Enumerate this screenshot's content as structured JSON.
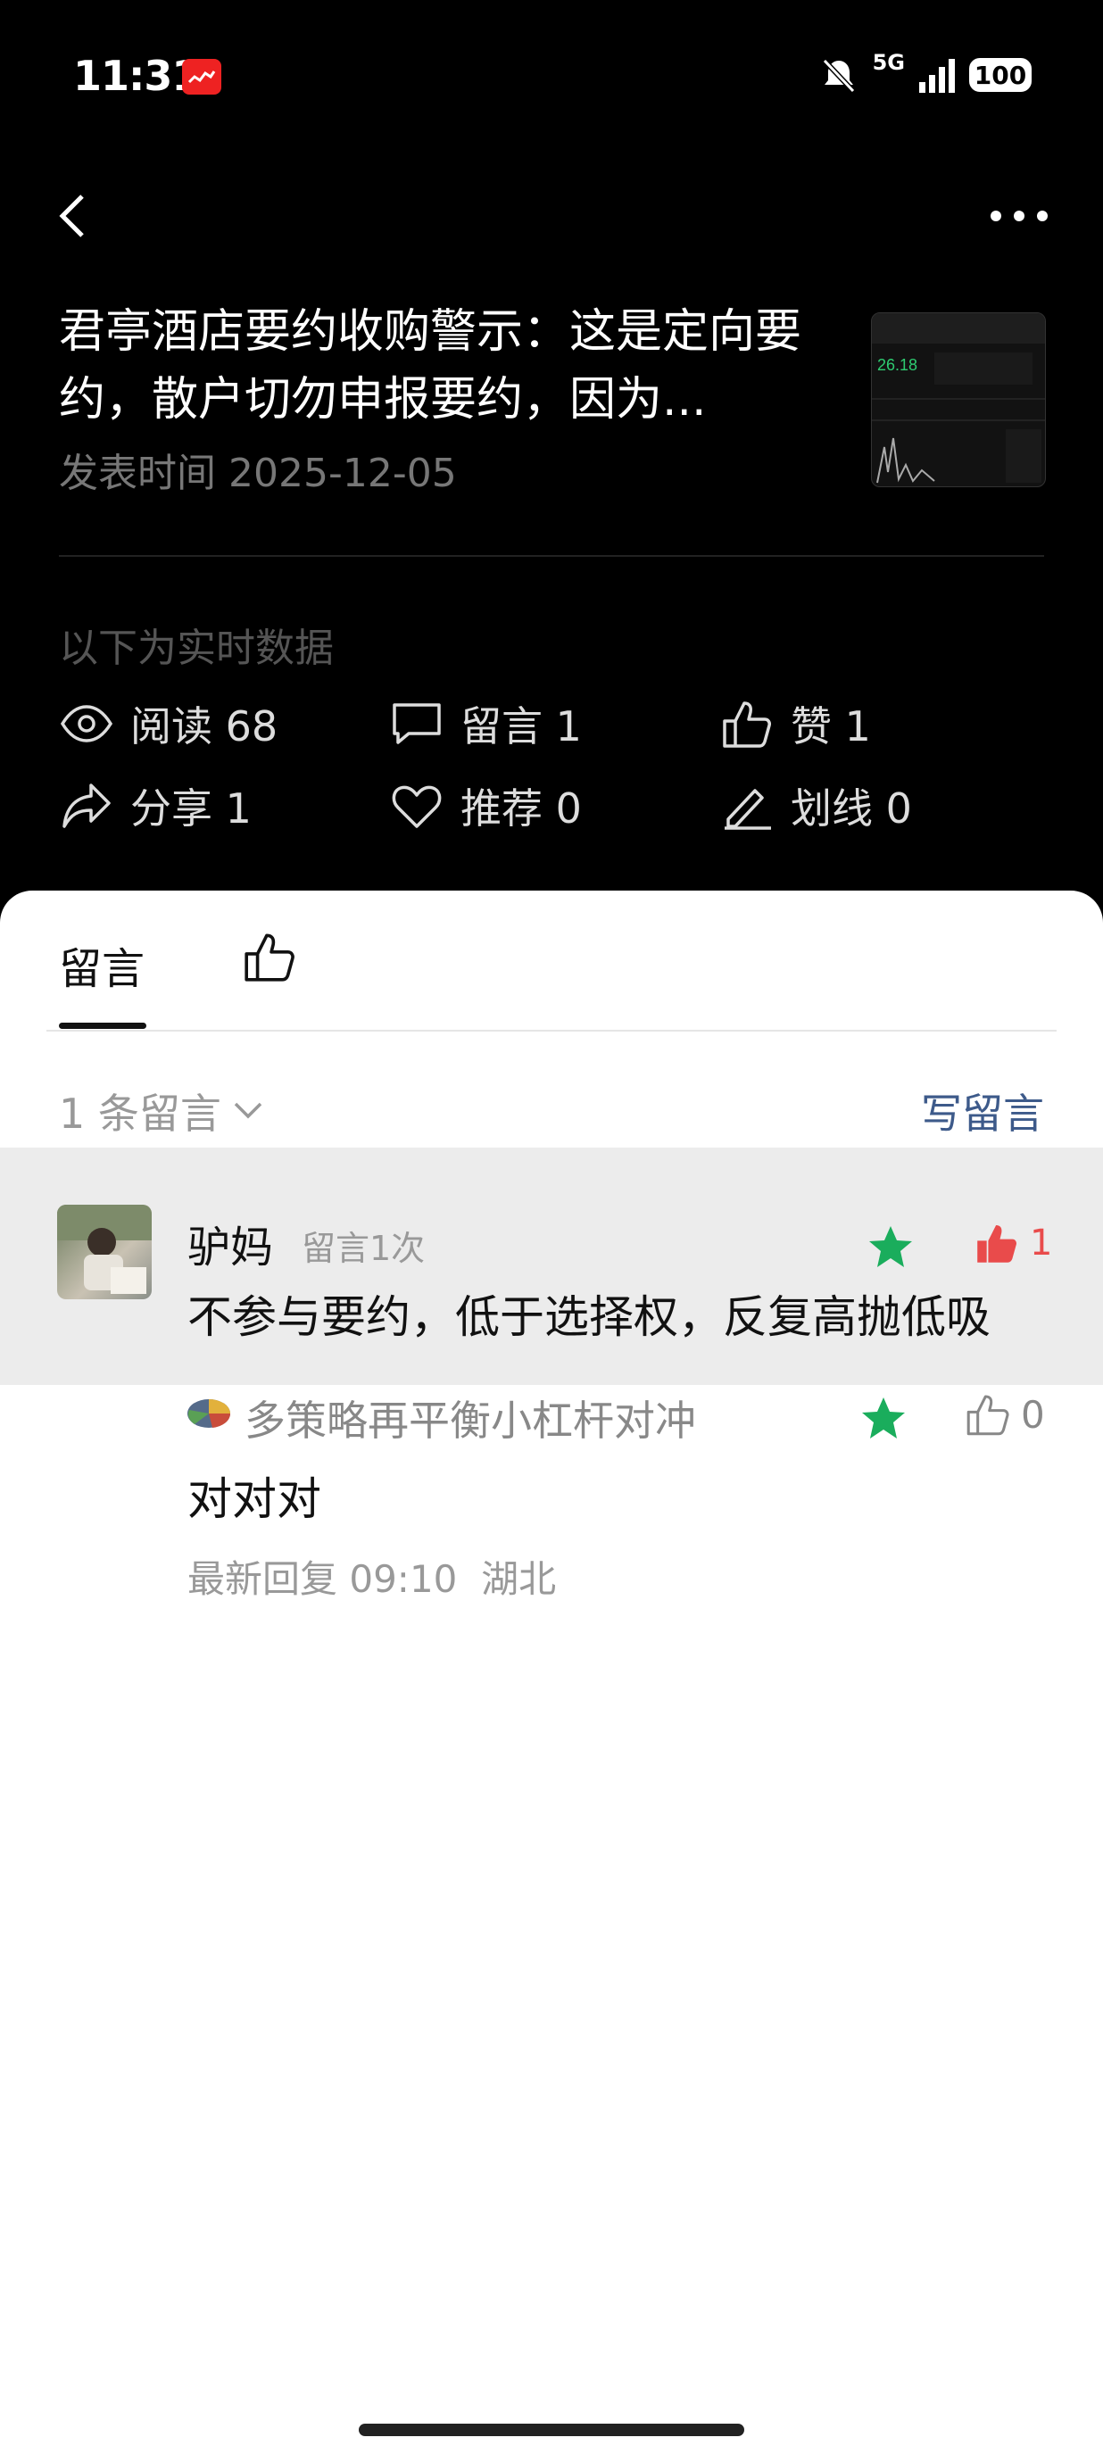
{
  "status_bar": {
    "time": "11:31",
    "network": "5G",
    "battery": "100"
  },
  "header": {
    "back_icon": "chevron-left-icon",
    "more_icon": "more-horizontal-icon"
  },
  "article": {
    "title": "君亭酒店要约收购警示：这是定向要约，散户切勿申报要约，因为...",
    "publish_time": "发表时间 2025-12-05"
  },
  "stats": {
    "label": "以下为实时数据",
    "read": "阅读 68",
    "comment": "留言 1",
    "like": "赞 1",
    "share": "分享 1",
    "recommend": "推荐 0",
    "underline": "划线 0"
  },
  "tabs": {
    "comments": "留言",
    "likes_icon": "thumbs-up-icon"
  },
  "comments_section": {
    "count": "1 条留言",
    "write": "写留言",
    "items": [
      {
        "author": "驴妈",
        "meta": "留言1次",
        "text": "不参与要约，低于选择权，反复高抛低吸",
        "likes": "1",
        "reply": {
          "author": "多策略再平衡小杠杆对冲",
          "text": "对对对",
          "likes": "0",
          "footer": "最新回复 09:10  湖北"
        }
      }
    ]
  },
  "colors": {
    "accent_red": "#e94b4b",
    "star_green": "#1aad5c",
    "link_blue": "#3d5a8a"
  }
}
